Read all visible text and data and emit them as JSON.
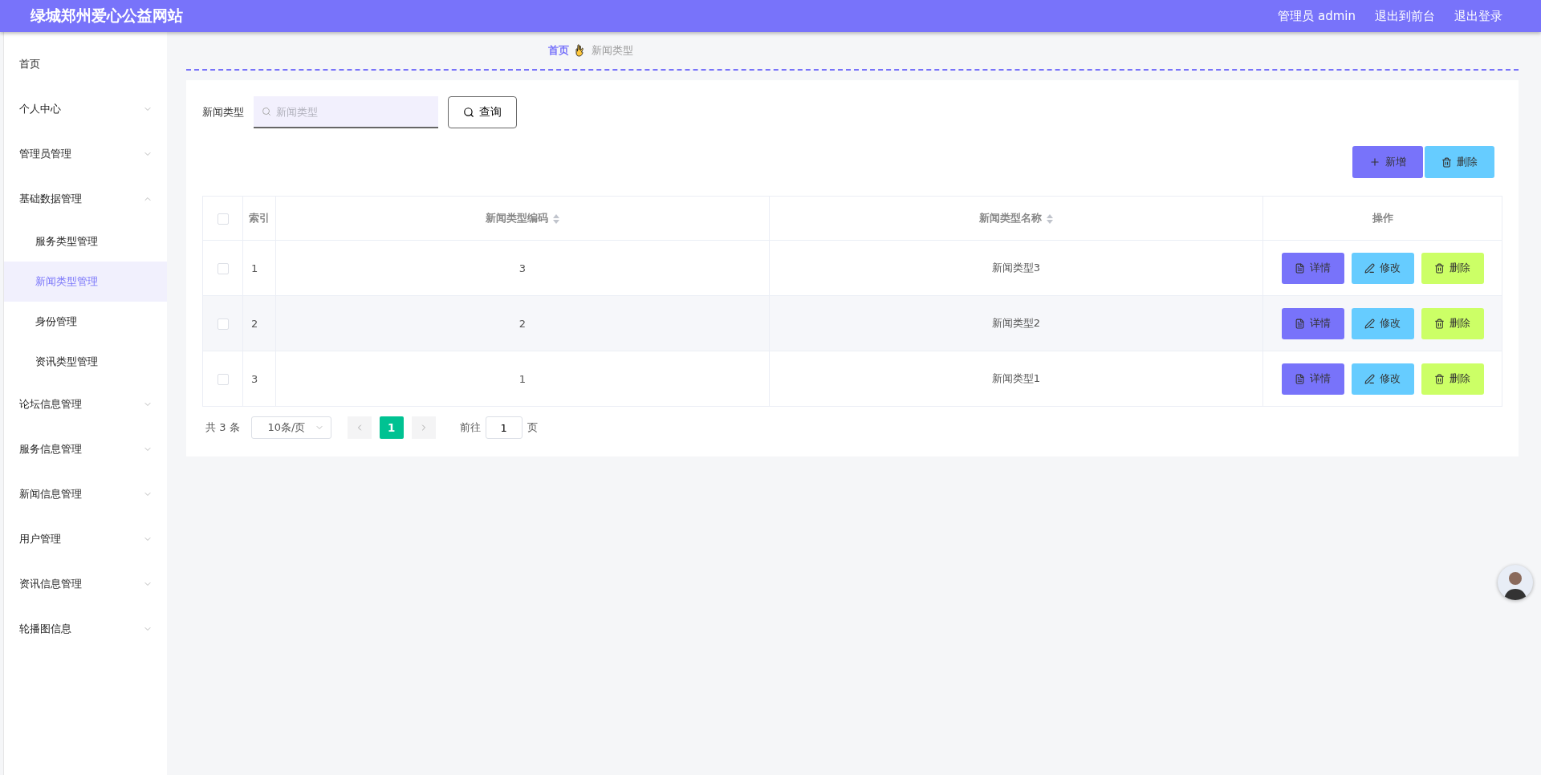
{
  "header": {
    "title": "绿城郑州爱心公益网站",
    "links": [
      "管理员 admin",
      "退出到前台",
      "退出登录"
    ]
  },
  "sidebar": {
    "items": [
      {
        "label": "首页",
        "kind": "link",
        "selected": false
      },
      {
        "label": "个人中心",
        "kind": "menu",
        "expanded": false
      },
      {
        "label": "管理员管理",
        "kind": "menu",
        "expanded": false
      },
      {
        "label": "基础数据管理",
        "kind": "menu",
        "expanded": true,
        "children": [
          {
            "label": "服务类型管理",
            "selected": false
          },
          {
            "label": "新闻类型管理",
            "selected": true
          },
          {
            "label": "身份管理",
            "selected": false
          },
          {
            "label": "资讯类型管理",
            "selected": false
          }
        ]
      },
      {
        "label": "论坛信息管理",
        "kind": "menu",
        "expanded": false
      },
      {
        "label": "服务信息管理",
        "kind": "menu",
        "expanded": false
      },
      {
        "label": "新闻信息管理",
        "kind": "menu",
        "expanded": false
      },
      {
        "label": "用户管理",
        "kind": "menu",
        "expanded": false
      },
      {
        "label": "资讯信息管理",
        "kind": "menu",
        "expanded": false
      },
      {
        "label": "轮播图信息",
        "kind": "menu",
        "expanded": false
      }
    ]
  },
  "breadcrumb": [
    "首页",
    "新闻类型"
  ],
  "search": {
    "label": "新闻类型",
    "placeholder": "新闻类型",
    "button": "查询"
  },
  "toolbar": [
    {
      "label": "新增",
      "kind": "add"
    },
    {
      "label": "删除",
      "kind": "delete"
    }
  ],
  "table": {
    "all_checked": false,
    "columns": [
      {
        "label": "索引",
        "sortable": false
      },
      {
        "label": "新闻类型编码",
        "sortable": true
      },
      {
        "label": "新闻类型名称",
        "sortable": true
      },
      {
        "label": "操作",
        "sortable": false
      }
    ],
    "rows": [
      {
        "checked": false,
        "index": "1",
        "code": "3",
        "name": "新闻类型3",
        "actions": [
          {
            "label": "详情",
            "kind": "detail"
          },
          {
            "label": "修改",
            "kind": "edit"
          },
          {
            "label": "删除",
            "kind": "delete"
          }
        ]
      },
      {
        "checked": false,
        "index": "2",
        "code": "2",
        "name": "新闻类型2",
        "actions": [
          {
            "label": "详情",
            "kind": "detail"
          },
          {
            "label": "修改",
            "kind": "edit"
          },
          {
            "label": "删除",
            "kind": "delete"
          }
        ]
      },
      {
        "checked": false,
        "index": "3",
        "code": "1",
        "name": "新闻类型1",
        "actions": [
          {
            "label": "详情",
            "kind": "detail"
          },
          {
            "label": "修改",
            "kind": "edit"
          },
          {
            "label": "删除",
            "kind": "delete"
          }
        ]
      }
    ]
  },
  "pagination": {
    "total": "共 3 条",
    "page_size": "10条/页",
    "pages": [
      {
        "label": "1",
        "selected": true
      }
    ],
    "goto_label": "前往",
    "goto_value": "1",
    "goto_suffix": "页"
  }
}
